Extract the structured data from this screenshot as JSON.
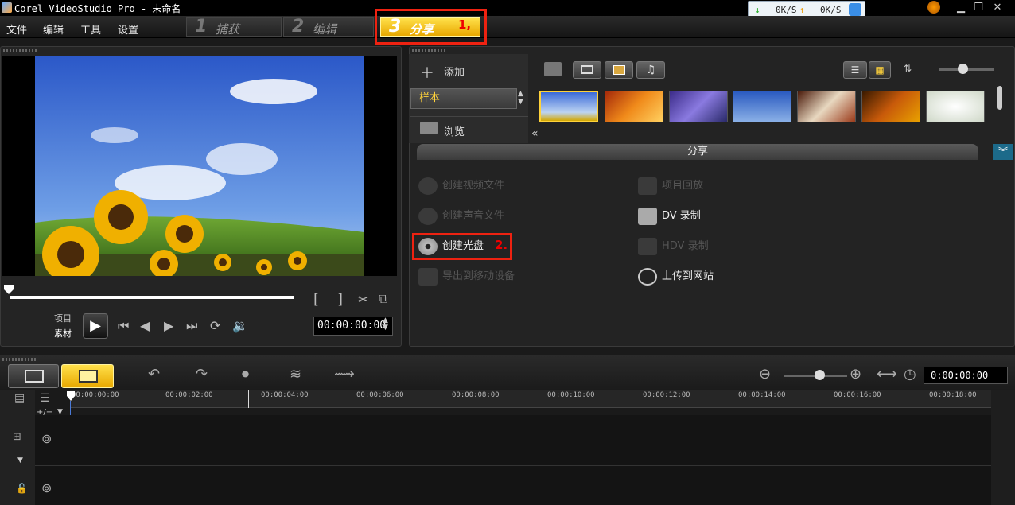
{
  "window": {
    "title": "Corel VideoStudio Pro - 未命名",
    "net_down": "0K/S",
    "net_up": "0K/S"
  },
  "menu": {
    "items": [
      "文件",
      "编辑",
      "工具",
      "设置"
    ]
  },
  "steps": [
    {
      "num": "1",
      "label": "捕获"
    },
    {
      "num": "2",
      "label": "编辑"
    },
    {
      "num": "3",
      "label": "分享"
    }
  ],
  "annotations": {
    "step3": "1,",
    "disc": "2."
  },
  "preview": {
    "project_label": "项目",
    "clip_label": "素材",
    "timecode": "00:00:00:00",
    "mark_in": "[",
    "mark_out": "]"
  },
  "library": {
    "add_label": "添加",
    "sample_label": "样本",
    "browse_label": "浏览",
    "share_header": "分享"
  },
  "share": {
    "left": [
      {
        "label": "创建视频文件",
        "enabled": false,
        "icon": "film-reel-icon"
      },
      {
        "label": "创建声音文件",
        "enabled": false,
        "icon": "audio-file-icon"
      },
      {
        "label": "创建光盘",
        "enabled": true,
        "icon": "disc-icon"
      },
      {
        "label": "导出到移动设备",
        "enabled": false,
        "icon": "mobile-device-icon"
      }
    ],
    "right": [
      {
        "label": "项目回放",
        "enabled": false,
        "icon": "playback-icon"
      },
      {
        "label": "DV 录制",
        "enabled": true,
        "icon": "dv-camera-icon"
      },
      {
        "label": "HDV 录制",
        "enabled": false,
        "icon": "hdv-camera-icon"
      },
      {
        "label": "上传到网站",
        "enabled": true,
        "icon": "globe-icon"
      }
    ]
  },
  "timeline": {
    "timecode": "0:00:00:00",
    "ticks": [
      "00:00:00:00",
      "00:00:02:00",
      "00:00:04:00",
      "00:00:06:00",
      "00:00:08:00",
      "00:00:10:00",
      "00:00:12:00",
      "00:00:14:00",
      "00:00:16:00",
      "00:00:18:00"
    ],
    "plus_minus": "+/−"
  },
  "colors": {
    "accent": "#ffd23a",
    "annotation": "#e21f1f"
  }
}
